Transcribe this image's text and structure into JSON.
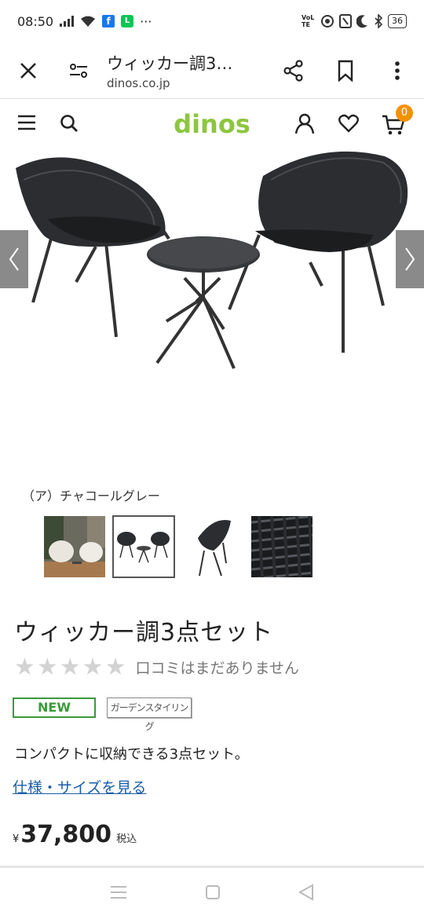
{
  "status": {
    "time": "08:50",
    "battery": "36",
    "more": "···",
    "volte": "VoLTE"
  },
  "browser": {
    "title": "ウィッカー調3…",
    "domain": "dinos.co.jp"
  },
  "site": {
    "logo": "dinos",
    "cart_count": "0"
  },
  "product": {
    "color_label": "（ア）チャコールグレー",
    "title": "ウィッカー調3点セット",
    "stars": "★★★★★",
    "rating_text": "口コミはまだありません",
    "badge_new": "NEW",
    "badge_category": "ガーデンスタイリング",
    "description": "コンパクトに収納できる3点セット。",
    "spec_link": "仕様・サイズを見る",
    "currency": "¥",
    "price": "37,800",
    "tax_label": "税込"
  },
  "colors": {
    "logo_green": "#8cc63f",
    "cart_badge": "#f39200",
    "link_blue": "#1a5ea8",
    "new_green": "#3a9a3a"
  }
}
